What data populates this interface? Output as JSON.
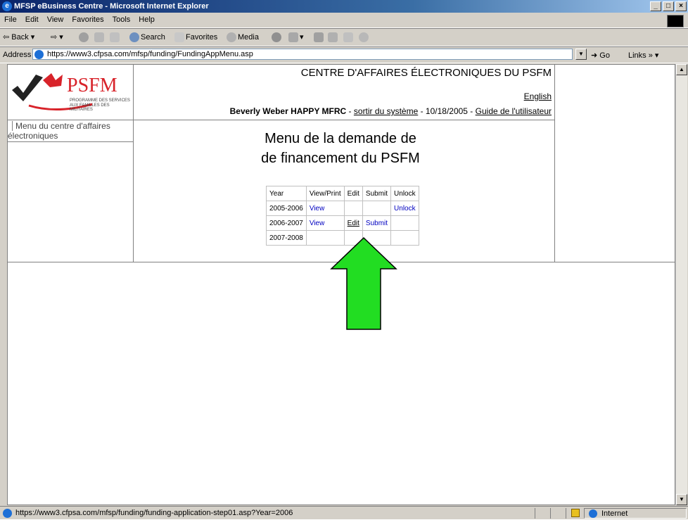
{
  "window": {
    "title": "MFSP eBusiness Centre - Microsoft Internet Explorer",
    "controls": [
      "_",
      "□",
      "×"
    ]
  },
  "menubar": {
    "items": [
      "File",
      "Edit",
      "View",
      "Favorites",
      "Tools",
      "Help"
    ]
  },
  "toolbar": {
    "back": "Back",
    "search": "Search",
    "favorites": "Favorites",
    "media": "Media"
  },
  "addressbar": {
    "label": "Address",
    "url": "https://www3.cfpsa.com/mfsp/funding/FundingAppMenu.asp",
    "go": "Go",
    "links": "Links"
  },
  "header": {
    "logo_text": "PSFM",
    "logo_sub1": "PROGRAMME DES SERVICES",
    "logo_sub2": "AUX FAMILLES DES MILITAIRES",
    "title": "CENTRE D'AFFAIRES ÉLECTRONIQUES DU PSFM",
    "english_link": "English",
    "user": "Beverly Weber HAPPY MFRC",
    "sep1": " - ",
    "logout": "sortir du système",
    "date_sep": " - 10/18/2005 - ",
    "guide": "Guide de l'utilisateur"
  },
  "sidebar": {
    "nav_line1": "Menu du centre d'affaires",
    "nav_line2": "électroniques"
  },
  "main": {
    "title_line1": "Menu de la demande de",
    "title_line2": "de financement du PSFM",
    "table": {
      "headers": [
        "Year",
        "View/Print",
        "Edit",
        "Submit",
        "Unlock"
      ],
      "rows": [
        {
          "year": "2005-2006",
          "view": "View",
          "edit": "",
          "submit": "",
          "unlock": "Unlock"
        },
        {
          "year": "2006-2007",
          "view": "View",
          "edit": "Edit",
          "submit": "Submit",
          "unlock": ""
        },
        {
          "year": "2007-2008",
          "view": "",
          "edit": "",
          "submit": "",
          "unlock": ""
        }
      ]
    }
  },
  "status": {
    "text": "https://www3.cfpsa.com/mfsp/funding/funding-application-step01.asp?Year=2006",
    "zone": "Internet"
  },
  "colors": {
    "arrow": "#22dd22",
    "link": "#0000c0",
    "logo_red": "#d8232a"
  }
}
